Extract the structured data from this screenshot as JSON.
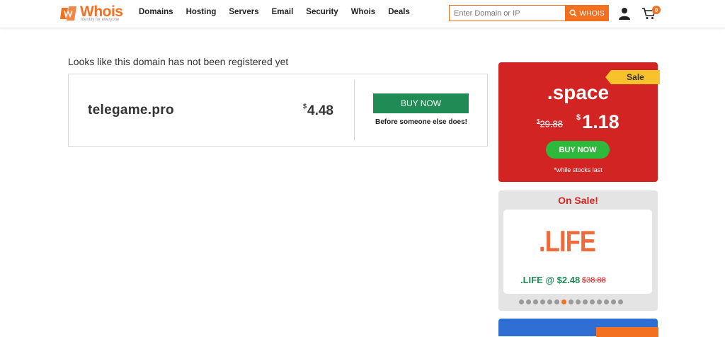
{
  "header": {
    "logo_text": "Whois",
    "logo_tagline": "Identity for everyone",
    "nav": [
      "Domains",
      "Hosting",
      "Servers",
      "Email",
      "Security",
      "Whois",
      "Deals"
    ],
    "search_placeholder": "Enter Domain or IP",
    "search_button": "WHOIS",
    "cart_count": "0",
    "colors": {
      "brand": "#f37021"
    }
  },
  "main": {
    "notice": "Looks like this domain has not been registered yet",
    "domain": "telegame.pro",
    "currency": "$",
    "price": "4.48",
    "buy_label": "BUY NOW",
    "buy_sub": "Before someone else does!",
    "colors": {
      "buy": "#1e8c54"
    }
  },
  "sidebar": {
    "promo1": {
      "ribbon": "Sale",
      "tld": ".space",
      "old_currency": "$",
      "old_price": "29.88",
      "new_currency": "$",
      "new_price": "1.18",
      "button": "BUY NOW",
      "note": "*while stocks last",
      "colors": {
        "bg": "#d22423",
        "button": "#2eb93c",
        "ribbon": "#f8c22c"
      }
    },
    "promo2": {
      "title": "On Sale!",
      "logo_text": ".LIFE",
      "deal": ".LIFE @ $2.48",
      "old_price": "$38.88",
      "dots_total": 15,
      "dots_active_index": 6
    }
  }
}
